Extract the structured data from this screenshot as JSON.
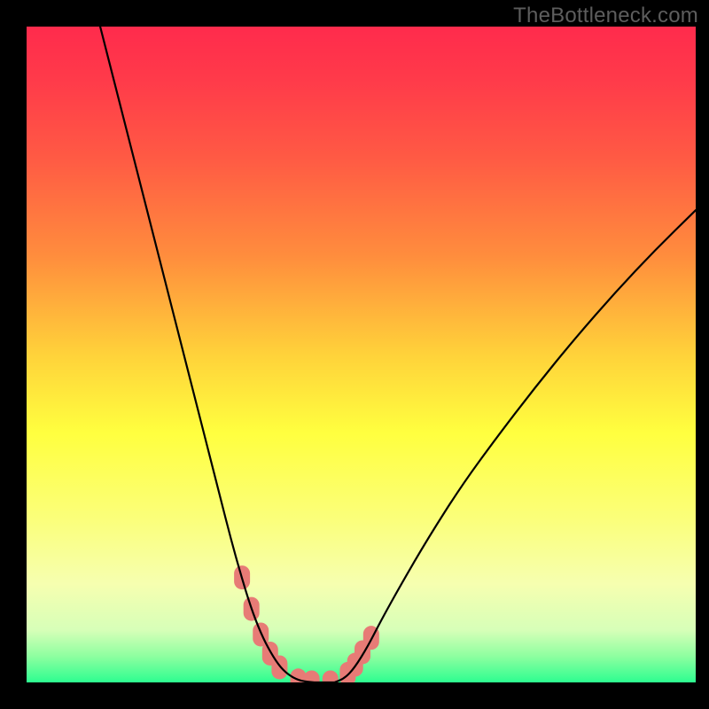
{
  "watermark": "TheBottleneck.com",
  "colors": {
    "frame": "#000000",
    "curve": "#000000",
    "marker": "#e77b76",
    "gradient_stops": [
      {
        "offset": 0.0,
        "color": "#ff2b4c"
      },
      {
        "offset": 0.08,
        "color": "#ff3a4a"
      },
      {
        "offset": 0.2,
        "color": "#ff5a44"
      },
      {
        "offset": 0.35,
        "color": "#ff8d3d"
      },
      {
        "offset": 0.5,
        "color": "#ffd23a"
      },
      {
        "offset": 0.62,
        "color": "#ffff3f"
      },
      {
        "offset": 0.75,
        "color": "#fbff7a"
      },
      {
        "offset": 0.85,
        "color": "#f6ffb0"
      },
      {
        "offset": 0.92,
        "color": "#d7ffb8"
      },
      {
        "offset": 0.96,
        "color": "#8effa0"
      },
      {
        "offset": 1.0,
        "color": "#2dfd90"
      }
    ]
  },
  "chart_data": {
    "type": "line",
    "title": "",
    "xlabel": "",
    "ylabel": "",
    "xlim": [
      0,
      100
    ],
    "ylim": [
      0,
      100
    ],
    "series": [
      {
        "name": "left-curve",
        "x": [
          11,
          13,
          15,
          17,
          19,
          21,
          23,
          25,
          27,
          29,
          30.5,
          32,
          33.5,
          35,
          36.5,
          38,
          39.5,
          41,
          43
        ],
        "y": [
          100,
          92,
          84,
          76,
          68,
          60,
          52,
          44,
          36,
          28,
          22,
          16.5,
          11.5,
          7.5,
          4.5,
          2.2,
          0.9,
          0.2,
          0
        ]
      },
      {
        "name": "valley-floor",
        "x": [
          43,
          44.5,
          46
        ],
        "y": [
          0,
          0,
          0
        ]
      },
      {
        "name": "right-curve",
        "x": [
          46,
          47.5,
          49,
          51,
          53,
          56,
          60,
          65,
          70,
          76,
          82,
          88,
          94,
          100
        ],
        "y": [
          0,
          0.6,
          2.2,
          5.5,
          9.5,
          15,
          22,
          30,
          37,
          45,
          52.5,
          59.5,
          66,
          72
        ]
      }
    ],
    "highlight_points": {
      "name": "markers",
      "x": [
        32.2,
        33.6,
        35.0,
        36.4,
        37.8,
        40.6,
        42.6,
        45.4,
        48.0,
        49.1,
        50.2,
        51.5
      ],
      "y": [
        16.0,
        11.2,
        7.3,
        4.4,
        2.3,
        0.3,
        0.0,
        0.0,
        1.3,
        2.7,
        4.6,
        6.8
      ]
    }
  }
}
